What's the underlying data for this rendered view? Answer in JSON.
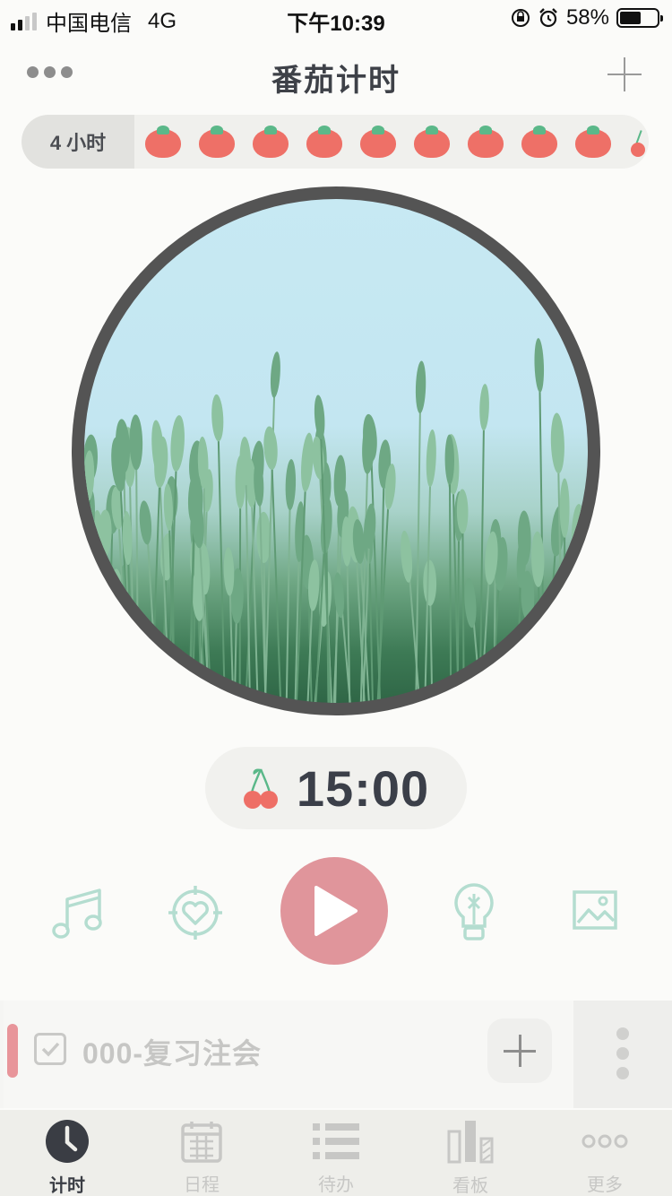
{
  "status_bar": {
    "carrier": "中国电信",
    "network": "4G",
    "time": "下午10:39",
    "battery": "58%"
  },
  "nav": {
    "title": "番茄计时",
    "menu_icon": "more-dots-icon",
    "add_icon": "plus-icon"
  },
  "strip": {
    "hours_label": "4 小时",
    "tomato_count": 9,
    "tomato_icon": "tomato-icon",
    "tail_icon": "cherry-icon"
  },
  "timer": {
    "icon": "cherry-icon",
    "time": "15:00"
  },
  "controls": {
    "music_icon": "music-note-icon",
    "focus_icon": "target-heart-icon",
    "play_icon": "play-icon",
    "idea_icon": "lightbulb-icon",
    "image_icon": "image-icon",
    "play_color": "#e0959b",
    "icon_color": "#b4ddd0"
  },
  "task": {
    "label": "000-复习注会",
    "accent_color": "#e8959a"
  },
  "tabs": [
    {
      "label": "计时",
      "icon": "clock-icon",
      "active": true
    },
    {
      "label": "日程",
      "icon": "calendar-icon",
      "active": false
    },
    {
      "label": "待办",
      "icon": "list-icon",
      "active": false
    },
    {
      "label": "看板",
      "icon": "bar-chart-icon",
      "active": false
    },
    {
      "label": "更多",
      "icon": "more-dots-icon",
      "active": false
    }
  ]
}
